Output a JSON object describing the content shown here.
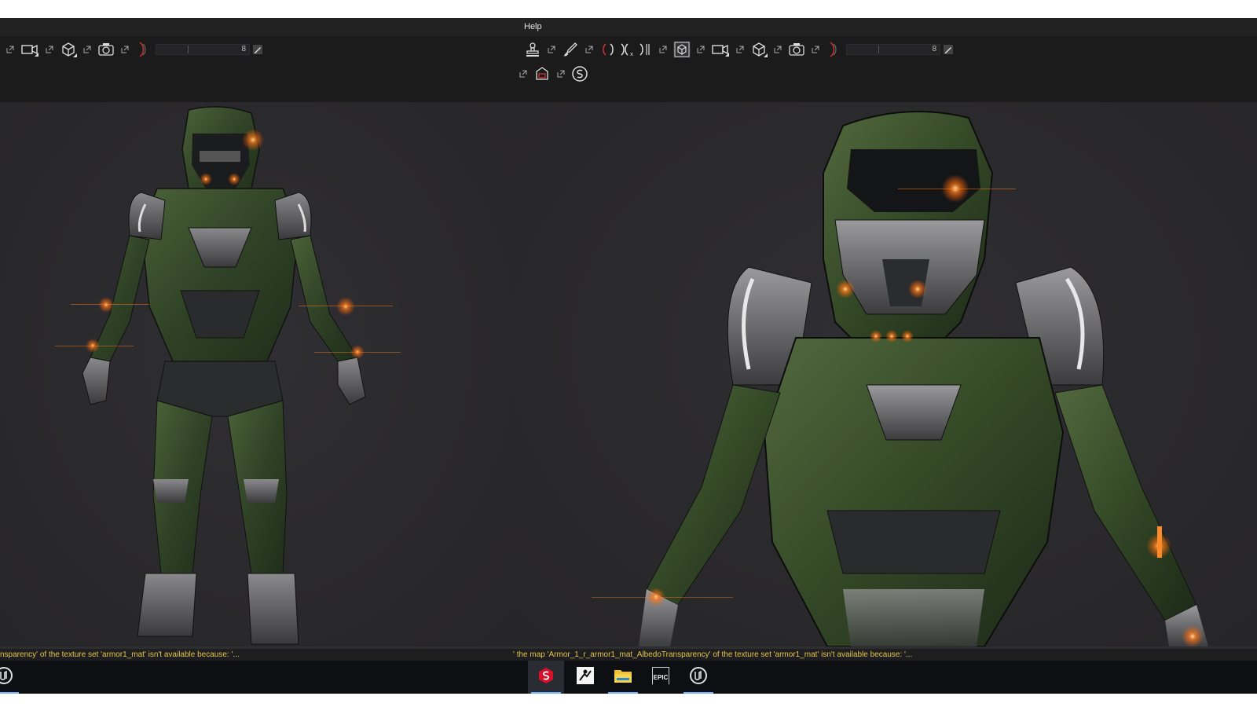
{
  "menu": {
    "help_label": "Help"
  },
  "left_toolbar": {
    "slider_value": "8"
  },
  "right_toolbar": {
    "slider_value": "8"
  },
  "status": {
    "left_text": "nsparency' of the texture set 'armor1_mat' isn't available because: '...",
    "right_text": "' the map 'Armor_1_r_armor1_mat_AlbedoTransparency' of the texture set 'armor1_mat' isn't available because: '..."
  },
  "taskbar": {
    "items": [
      "unreal-engine-icon",
      "substance-painter-icon",
      "zbrush-icon",
      "file-explorer-icon",
      "epic-games-icon",
      "unreal-engine-icon"
    ],
    "epic_label": "EPIC"
  },
  "colors": {
    "status_warning": "#e2c44d",
    "armor_green": "#3b5230",
    "glow_orange": "#ff7a1a",
    "taskbar_accent": "#6fb1ff"
  }
}
